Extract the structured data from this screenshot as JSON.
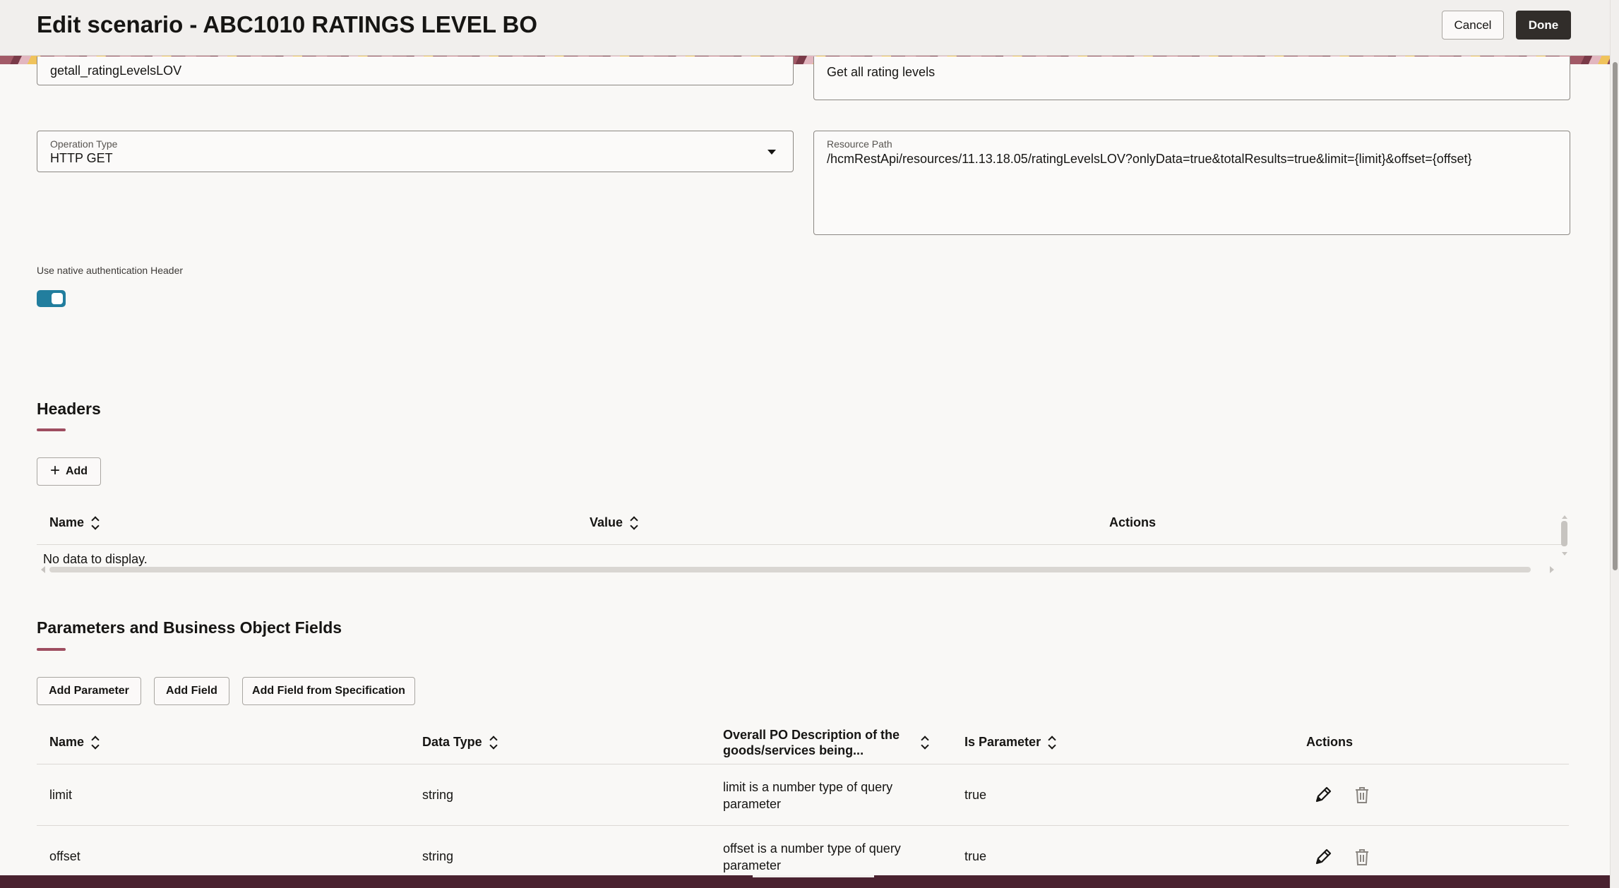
{
  "header": {
    "title": "Edit scenario - ABC1010 RATINGS LEVEL BO",
    "cancel_label": "Cancel",
    "done_label": "Done"
  },
  "form": {
    "name_value": "getall_ratingLevelsLOV",
    "description_value": "Get all rating levels",
    "operation_type": {
      "label": "Operation Type",
      "value": "HTTP GET"
    },
    "resource_path": {
      "label": "Resource Path",
      "value": "/hcmRestApi/resources/11.13.18.05/ratingLevelsLOV?onlyData=true&totalResults=true&limit={limit}&offset={offset}"
    },
    "native_auth": {
      "label": "Use native authentication Header",
      "enabled": true
    }
  },
  "headers_section": {
    "title": "Headers",
    "add_label": "Add",
    "columns": [
      "Name",
      "Value",
      "Actions"
    ],
    "empty_text": "No data to display."
  },
  "params_section": {
    "title": "Parameters and Business Object Fields",
    "buttons": [
      "Add Parameter",
      "Add Field",
      "Add Field from Specification"
    ],
    "columns": [
      "Name",
      "Data Type",
      "Overall PO Description of the goods/services being...",
      "Is Parameter",
      "Actions"
    ],
    "rows": [
      {
        "name": "limit",
        "data_type": "string",
        "description": "limit is a number type of query parameter",
        "is_parameter": "true"
      },
      {
        "name": "offset",
        "data_type": "string",
        "description": "offset is a number type of query parameter",
        "is_parameter": "true"
      }
    ]
  },
  "colors": {
    "accent": "#9e4d60",
    "toggle_on": "#227e9e",
    "primary_button": "#312d2a"
  },
  "icons": [
    "plus-icon",
    "sort-icon",
    "edit-icon",
    "delete-icon",
    "chevron-down-icon"
  ]
}
